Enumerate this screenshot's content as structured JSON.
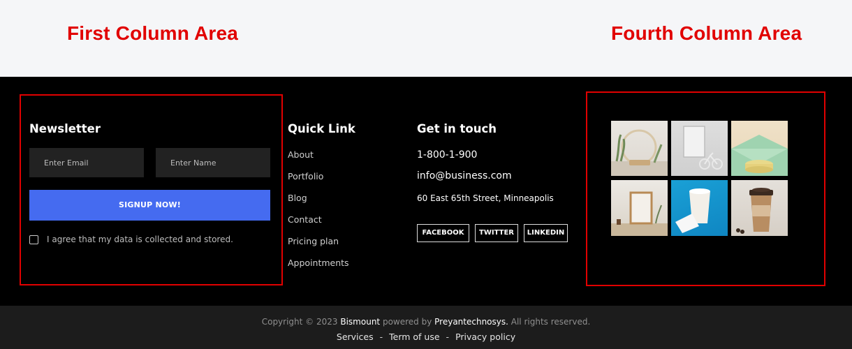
{
  "labels": {
    "first_column": "First Column Area",
    "fourth_column": "Fourth Column Area"
  },
  "newsletter": {
    "title": "Newsletter",
    "email_placeholder": "Enter Email",
    "name_placeholder": "Enter Name",
    "button_label": "SIGNUP NOW!",
    "agree_text": "I agree that my data is collected and stored."
  },
  "quick_links": {
    "title": "Quick Link",
    "items": [
      "About",
      "Portfolio",
      "Blog",
      "Contact",
      "Pricing plan",
      "Appointments"
    ]
  },
  "contact": {
    "title": "Get in touch",
    "phone": "1-800-1-900",
    "email": "info@business.com",
    "address": "60 East 65th Street, Minneapolis",
    "social": [
      "FACEBOOK",
      "TWITTER",
      "LINKEDIN"
    ]
  },
  "footer": {
    "copyright_prefix": "Copyright © 2023",
    "brand": "Bismount",
    "powered_by": "powered by",
    "company": "Preyantechnosys.",
    "rights": "All rights reserved.",
    "links": [
      "Services",
      "Term of use",
      "Privacy policy"
    ],
    "separator": "-"
  },
  "colors": {
    "accent_red": "#e10000",
    "button_blue": "#456bf0",
    "background": "#000000",
    "bottom_bar": "#1c1c1c"
  }
}
